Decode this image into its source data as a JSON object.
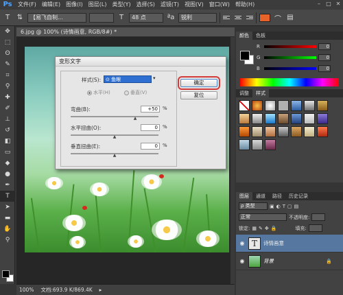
{
  "menubar": {
    "logo": "Ps",
    "items": [
      "文件(F)",
      "编辑(E)",
      "图像(I)",
      "图层(L)",
      "类型(Y)",
      "选择(S)",
      "滤镜(T)",
      "视图(V)",
      "窗口(W)",
      "帮助(H)"
    ]
  },
  "options_bar": {
    "font_family": "【易飞自制...",
    "font_size": "48 点",
    "antialias": "锐利",
    "text_color": "#e8632a"
  },
  "document": {
    "tab_title": "6.jpg @ 100% (诗情画意, RGB/8#) *",
    "zoom": "100%",
    "doc_size": "文档:693.9 K/869.4K"
  },
  "dialog": {
    "title": "变形文字",
    "style_label": "样式(S):",
    "style_value": "⊙ 鱼眼",
    "horizontal_label": "水平(H)",
    "vertical_label": "垂直(V)",
    "bend_label": "弯曲(B):",
    "bend_value": "+50",
    "hdist_label": "水平扭曲(O):",
    "hdist_value": "0",
    "vdist_label": "垂直扭曲(E):",
    "vdist_value": "0",
    "percent": "%",
    "ok_label": "确定",
    "reset_label": "复位"
  },
  "color_panel": {
    "tabs": [
      "颜色",
      "色板"
    ],
    "r_label": "R",
    "r_value": "0",
    "g_label": "G",
    "g_value": "0",
    "b_label": "B",
    "b_value": "0"
  },
  "styles_panel": {
    "tabs": [
      "调整",
      "样式"
    ]
  },
  "layers_panel": {
    "tabs": [
      "图层",
      "通道",
      "路径",
      "历史记录"
    ],
    "filter_label": "ρ 类型",
    "blend_mode": "正常",
    "opacity_label": "不透明度:",
    "lock_label": "锁定:",
    "fill_label": "填充:",
    "layers": [
      {
        "name": "诗情画意",
        "type": "text"
      },
      {
        "name": "背景",
        "type": "image"
      }
    ]
  }
}
